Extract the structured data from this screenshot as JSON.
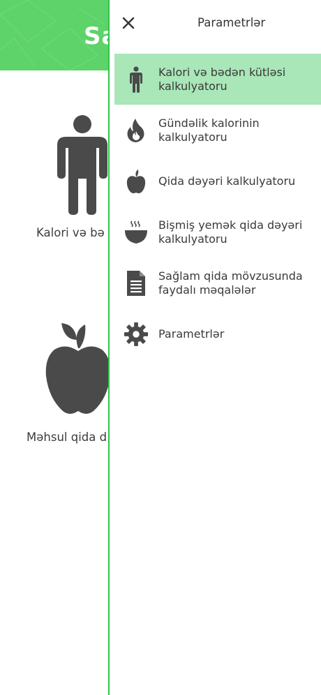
{
  "background": {
    "header_title": "Sa",
    "cards": [
      {
        "label": "Kalori və bə",
        "icon": "person-icon"
      },
      {
        "label": "Məhsul qida d",
        "icon": "apple-icon"
      }
    ]
  },
  "drawer": {
    "title": "Parametrlər",
    "close_icon": "close-icon",
    "items": [
      {
        "label": "Kalori və bədən kütləsi kalkulyatoru",
        "icon": "person-icon",
        "active": true
      },
      {
        "label": "Gündəlik kalorinin kalkulyatoru",
        "icon": "flame-icon",
        "active": false
      },
      {
        "label": "Qida dəyəri kalkulyatoru",
        "icon": "apple-icon",
        "active": false
      },
      {
        "label": "Bişmiş yemək qida dəyəri kalkulyatoru",
        "icon": "soup-bowl-icon",
        "active": false
      },
      {
        "label": "Sağlam qida mövzusunda faydalı məqalələr",
        "icon": "document-icon",
        "active": false
      },
      {
        "label": "Parametrlər",
        "icon": "gear-icon",
        "active": false
      }
    ]
  },
  "colors": {
    "header_green": "#5dd36a",
    "drawer_border": "#2fc34a",
    "active_item_bg": "#a9e6b8",
    "icon_gray": "#4a4a4a"
  }
}
